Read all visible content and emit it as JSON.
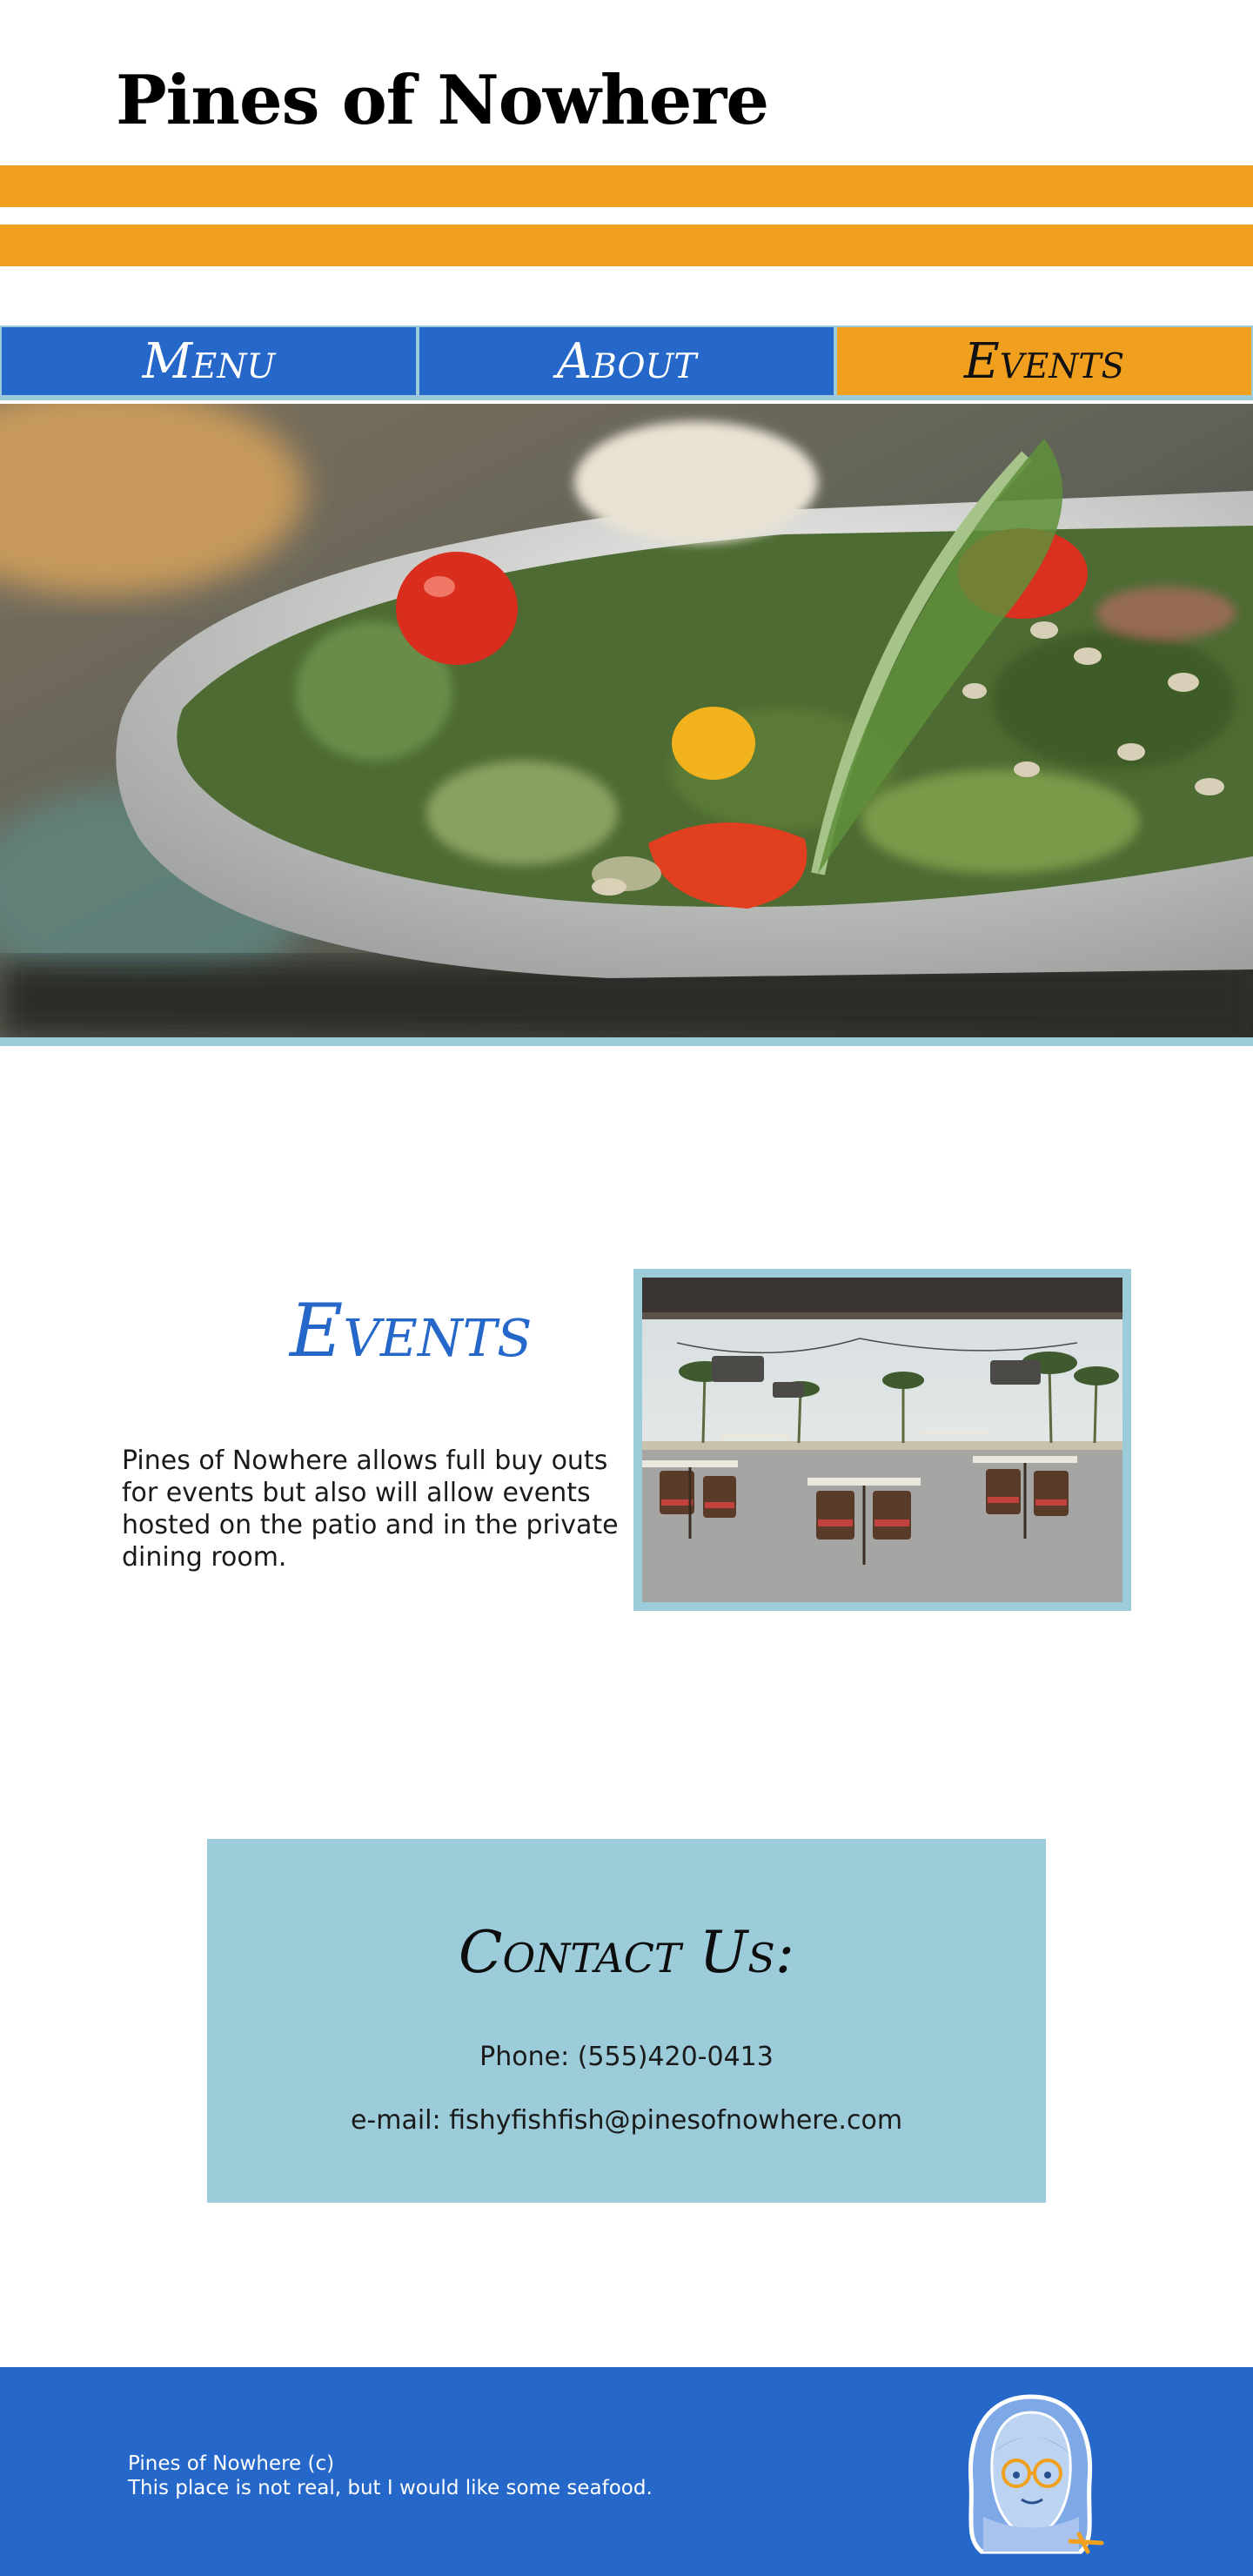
{
  "site": {
    "title": "Pines of Nowhere"
  },
  "colors": {
    "accent_orange": "#f0a01e",
    "brand_blue": "#2568c9",
    "light_blue": "#9ccbd9"
  },
  "nav": {
    "items": [
      {
        "label": "Menu",
        "active": false
      },
      {
        "label": "About",
        "active": false
      },
      {
        "label": "Events",
        "active": true
      }
    ]
  },
  "hero": {
    "image": "salad-bowl-photo"
  },
  "events": {
    "heading": "Events",
    "description": "Pines of Nowhere  allows full buy outs for events but also will allow events hosted on the patio and in the private dining room.",
    "image": "patio-dining-photo"
  },
  "contact": {
    "heading": "Contact Us:",
    "phone": "Phone: (555)420-0413",
    "email": "e-mail: fishyfishfish@pinesofnowhere.com"
  },
  "footer": {
    "line1": "Pines of Nowhere (c)",
    "line2": "This place is not real, but I would like some seafood.",
    "mascot": "mascot-illustration"
  }
}
